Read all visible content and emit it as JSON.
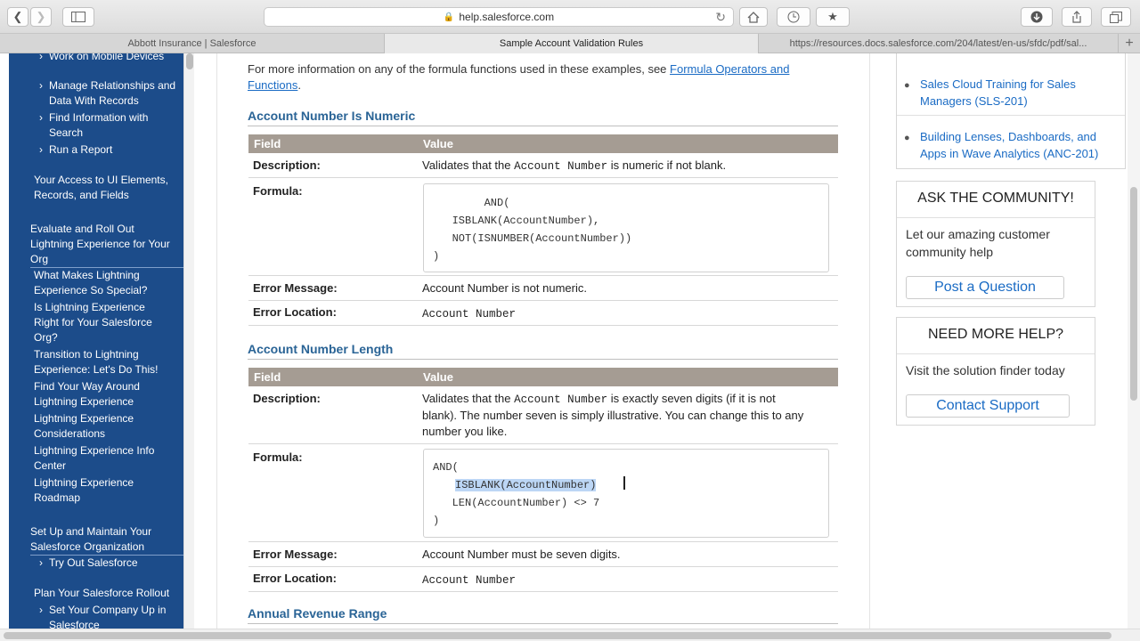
{
  "browser": {
    "url": "help.salesforce.com",
    "tabs": [
      {
        "label": "Abbott Insurance | Salesforce"
      },
      {
        "label": "Sample Account Validation Rules"
      },
      {
        "label": "https://resources.docs.salesforce.com/204/latest/en-us/sfdc/pdf/sal..."
      }
    ],
    "new_tab": "+"
  },
  "leftnav": {
    "items": [
      "Work on Mobile Devices",
      "Manage Relationships and Data With Records",
      "Find Information with Search",
      "Run a Report",
      "Your Access to UI Elements, Records, and Fields",
      "Evaluate and Roll Out Lightning Experience for Your Org",
      "What Makes Lightning Experience So Special?",
      "Is Lightning Experience Right for Your Salesforce Org?",
      "Transition to Lightning Experience: Let's Do This!",
      "Find Your Way Around Lightning Experience",
      "Lightning Experience Considerations",
      "Lightning Experience Info Center",
      "Lightning Experience Roadmap",
      "Set Up and Maintain Your Salesforce Organization",
      "Try Out Salesforce",
      "Plan Your Salesforce Rollout",
      "Set Your Company Up in Salesforce"
    ]
  },
  "main": {
    "intro_text": "For more information on any of the formula functions used in these examples, see ",
    "intro_link": "Formula Operators and Functions",
    "intro_end": ".",
    "col_field": "Field",
    "col_value": "Value",
    "lbl_description": "Description:",
    "lbl_formula": "Formula:",
    "lbl_error_message": "Error Message:",
    "lbl_error_location": "Error Location:",
    "rules": [
      {
        "title": "Account Number Is Numeric",
        "desc_pre": "Validates that the ",
        "desc_code": "Account Number",
        "desc_post": " is numeric if not blank.",
        "formula": [
          "        AND(",
          "   ISBLANK(AccountNumber),",
          "   NOT(ISNUMBER(AccountNumber))",
          ")"
        ],
        "error_message": "Account Number is not numeric.",
        "error_location": "Account Number"
      },
      {
        "title": "Account Number Length",
        "desc_pre": "Validates that the ",
        "desc_code": "Account Number",
        "desc_post": " is exactly seven digits (if it is not",
        "desc_line2": "blank). The number seven is simply illustrative. You can change this to any",
        "desc_line3": "number you like.",
        "formula_line1": "AND(",
        "formula_line2_hl": "ISBLANK(AccountNumber)",
        "formula_line3": "   LEN(AccountNumber) <> 7",
        "formula_line4": ")",
        "error_message": "Account Number must be seven digits.",
        "error_location": "Account Number"
      }
    ],
    "next_title": "Annual Revenue Range"
  },
  "right": {
    "courses": [
      "Sales Cloud Training for Sales Managers (SLS-201)",
      "Building Lenses, Dashboards, and Apps in Wave Analytics (ANC-201)"
    ],
    "community": {
      "title": "ASK THE COMMUNITY!",
      "text": "Let our amazing customer community help",
      "button": "Post a Question"
    },
    "help": {
      "title": "NEED MORE HELP?",
      "text": "Visit the solution finder today",
      "button": "Contact Support"
    }
  },
  "colors": {
    "nav_bg": "#1c4c8a",
    "section_heading": "#2a6496",
    "table_header": "#a59c93",
    "link": "#1a6bc4"
  }
}
